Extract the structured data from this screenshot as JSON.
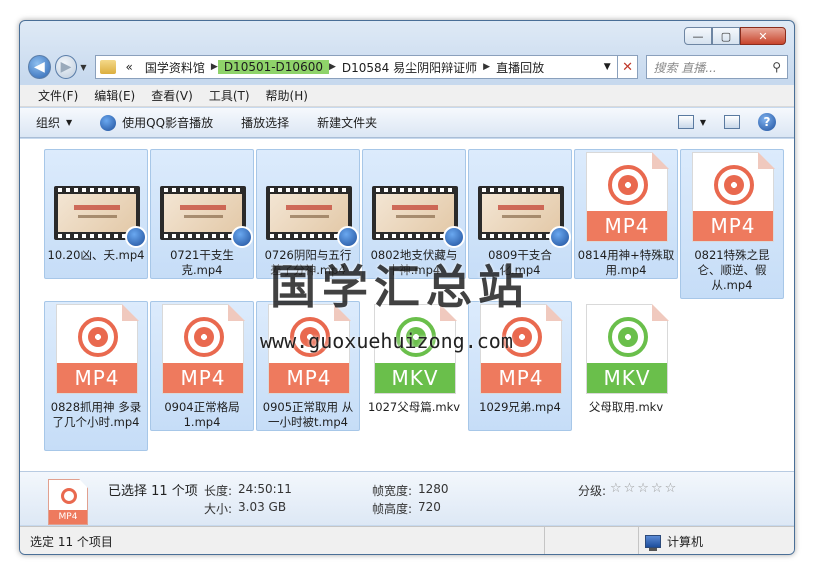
{
  "window": {
    "caption_buttons": {
      "minimize": "—",
      "maximize": "▢",
      "close": "✕"
    }
  },
  "nav": {
    "back_glyph": "◀",
    "forward_glyph": "▶",
    "dropdown_glyph": "▼",
    "breadcrumb": {
      "overflow": "«",
      "items": [
        "国学资料馆",
        "D10501-D10600",
        "D10584 易尘阴阳辩证师",
        "直播回放"
      ],
      "separator": "▶"
    },
    "address_dropdown": "▼",
    "address_clear": "✕",
    "search_placeholder": "搜索 直播...",
    "search_icon": "⚲"
  },
  "menu": [
    "文件(F)",
    "编辑(E)",
    "查看(V)",
    "工具(T)",
    "帮助(H)"
  ],
  "toolbar": {
    "organize": "组织",
    "play_qq": "使用QQ影音播放",
    "play_select": "播放选择",
    "new_folder": "新建文件夹",
    "dropdown_glyph": "▼",
    "help_glyph": "?"
  },
  "files": [
    {
      "name": "10.20凶、夭.mp4",
      "kind": "video",
      "selected": true
    },
    {
      "name": "0721干支生克.mp4",
      "kind": "video",
      "selected": true
    },
    {
      "name": "0726阴阳与五行差了分神.mp4",
      "kind": "video",
      "selected": true
    },
    {
      "name": "0802地支伏藏与十神.mp4",
      "kind": "video",
      "selected": true
    },
    {
      "name": "0809干支合化.mp4",
      "kind": "video",
      "selected": true
    },
    {
      "name": "0814用神+特殊取用.mp4",
      "kind": "mp4",
      "selected": true
    },
    {
      "name": "0821特殊之昆仑、顺逆、假从.mp4",
      "kind": "mp4",
      "selected": true
    },
    {
      "name": "0828抓用神 多录了几个小时.mp4",
      "kind": "mp4",
      "selected": true
    },
    {
      "name": "0904正常格局1.mp4",
      "kind": "mp4",
      "selected": true
    },
    {
      "name": "0905正常取用 从一小时被t.mp4",
      "kind": "mp4",
      "selected": true
    },
    {
      "name": "1027父母篇.mkv",
      "kind": "mkv",
      "selected": false
    },
    {
      "name": "1029兄弟.mp4",
      "kind": "mp4",
      "selected": true
    },
    {
      "name": "父母取用.mkv",
      "kind": "mkv",
      "selected": false
    }
  ],
  "labels": {
    "mp4": "MP4",
    "mkv": "MKV"
  },
  "watermark": {
    "title": "国学汇总站",
    "url": "www.guoxuehuizong.com"
  },
  "details": {
    "selected": "已选择 11 个项",
    "duration_label": "长度:",
    "duration_value": "24:50:11",
    "size_label": "大小:",
    "size_value": "3.03 GB",
    "width_label": "帧宽度:",
    "width_value": "1280",
    "height_label": "帧高度:",
    "height_value": "720",
    "rating_label": "分级:",
    "stars": "☆☆☆☆☆",
    "icon_label": "MP4"
  },
  "status": {
    "left": "选定 11 个项目",
    "right": "计算机"
  }
}
